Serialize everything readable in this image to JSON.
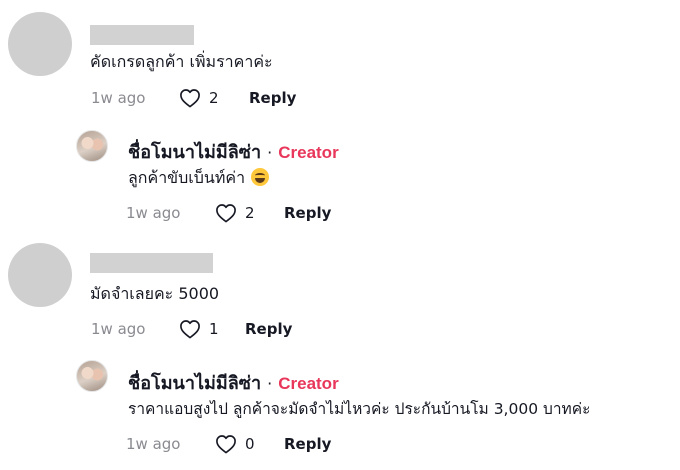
{
  "comments": [
    {
      "text": "คัดเกรดลูกค้า เพิ่มราคาค่ะ",
      "time": "1w ago",
      "likes": "2",
      "reply_label": "Reply",
      "reply": {
        "author": "ชื่อโมนาไม่มีลิซ่า",
        "separator": "·",
        "badge": "Creator",
        "text": "ลูกค้าขับเบ็นท์ค่า",
        "time": "1w ago",
        "likes": "2",
        "reply_label": "Reply"
      }
    },
    {
      "text": "มัดจำเลยคะ 5000",
      "time": "1w ago",
      "likes": "1",
      "reply_label": "Reply",
      "reply": {
        "author": "ชื่อโมนาไม่มีลิซ่า",
        "separator": "·",
        "badge": "Creator",
        "text": "ราคาแอบสูงไป ลูกค้าจะมัดจำไม่ไหวค่ะ ประกันบ้านโม 3,000 บาทค่ะ",
        "time": "1w ago",
        "likes": "0",
        "reply_label": "Reply"
      }
    }
  ]
}
